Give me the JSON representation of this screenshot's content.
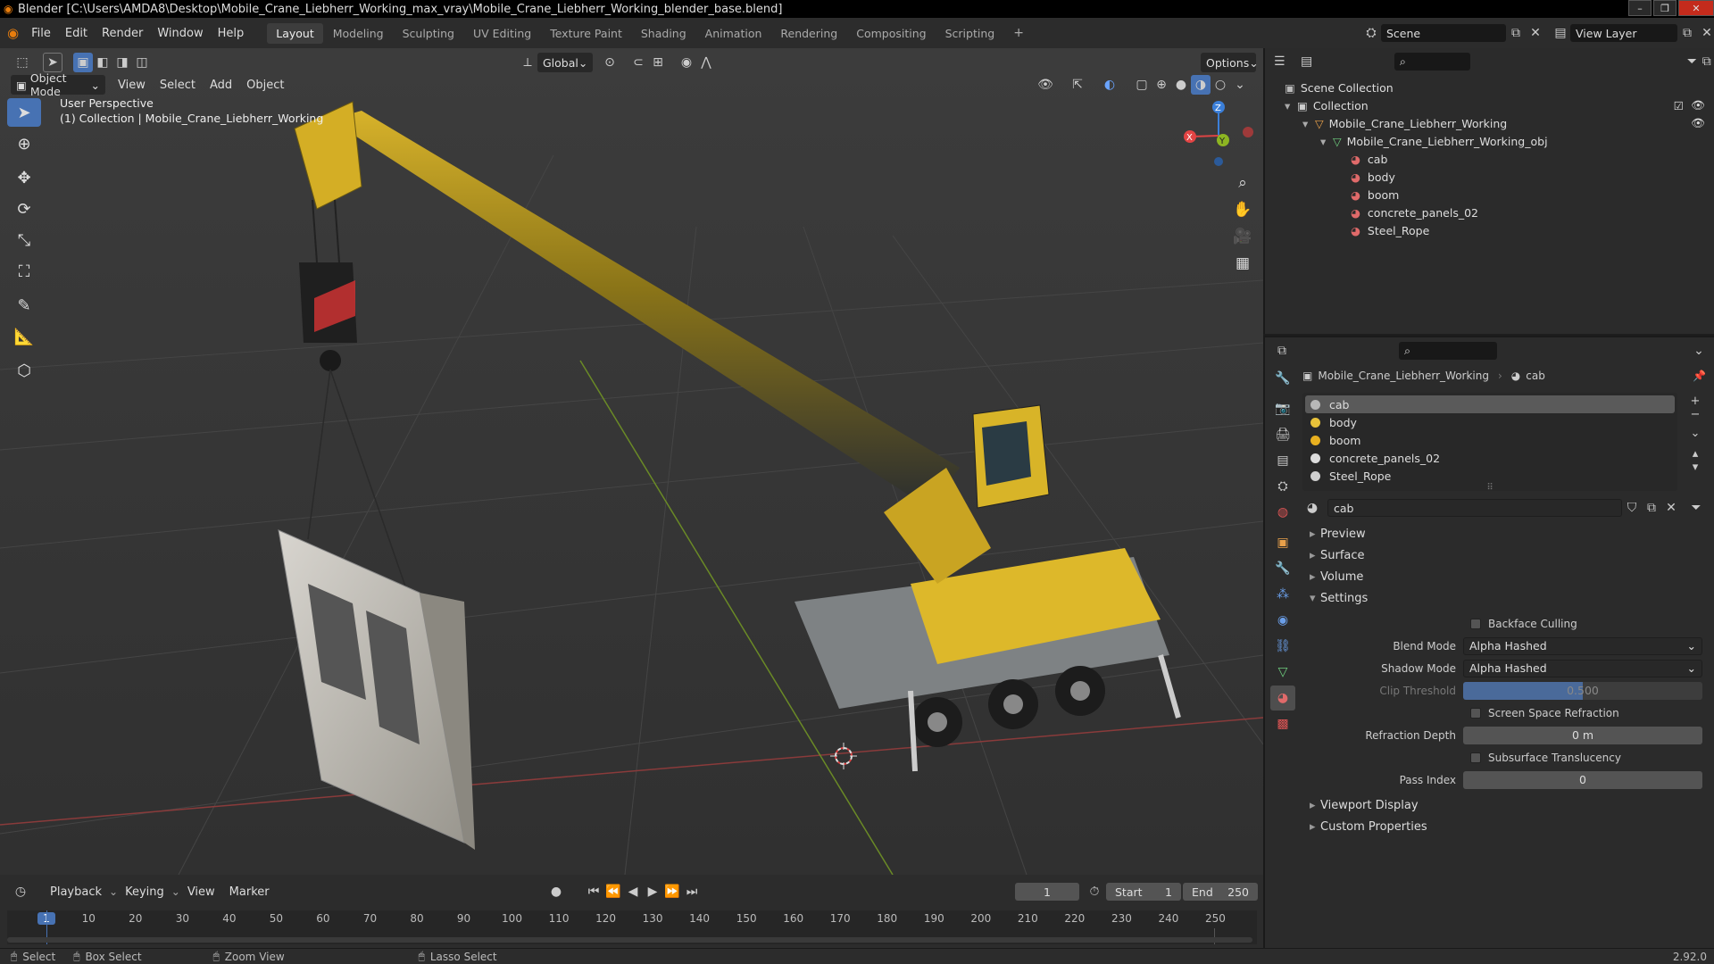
{
  "titlebar": {
    "title": "Blender [C:\\Users\\AMDA8\\Desktop\\Mobile_Crane_Liebherr_Working_max_vray\\Mobile_Crane_Liebherr_Working_blender_base.blend]"
  },
  "menu": [
    "File",
    "Edit",
    "Render",
    "Window",
    "Help"
  ],
  "workspaces": [
    "Layout",
    "Modeling",
    "Sculpting",
    "UV Editing",
    "Texture Paint",
    "Shading",
    "Animation",
    "Rendering",
    "Compositing",
    "Scripting"
  ],
  "scene": {
    "name": "Scene",
    "view_layer": "View Layer"
  },
  "viewport": {
    "mode": "Object Mode",
    "menus": [
      "View",
      "Select",
      "Add",
      "Object"
    ],
    "orientation": "Global",
    "options": "Options",
    "overlay_title": "User Perspective",
    "overlay_subtitle": "(1) Collection | Mobile_Crane_Liebherr_Working",
    "gizmo": {
      "x": "X",
      "y": "Y",
      "z": "Z"
    }
  },
  "outliner": {
    "scene_collection": "Scene Collection",
    "collection": "Collection",
    "object": "Mobile_Crane_Liebherr_Working",
    "mesh": "Mobile_Crane_Liebherr_Working_obj",
    "materials": [
      "cab",
      "body",
      "boom",
      "concrete_panels_02",
      "Steel_Rope"
    ]
  },
  "properties": {
    "breadcrumb_object": "Mobile_Crane_Liebherr_Working",
    "breadcrumb_material": "cab",
    "slots": [
      {
        "name": "cab",
        "color": "#b8b8b8"
      },
      {
        "name": "body",
        "color": "#e8c23a"
      },
      {
        "name": "boom",
        "color": "#e8b020"
      },
      {
        "name": "concrete_panels_02",
        "color": "#dcdcdc"
      },
      {
        "name": "Steel_Rope",
        "color": "#cfcfcf"
      }
    ],
    "material_name": "cab",
    "panels": {
      "preview": "Preview",
      "surface": "Surface",
      "volume": "Volume",
      "settings": "Settings",
      "viewport_display": "Viewport Display",
      "custom_properties": "Custom Properties"
    },
    "settings": {
      "backface_culling": "Backface Culling",
      "blend_mode_label": "Blend Mode",
      "blend_mode": "Alpha Hashed",
      "shadow_mode_label": "Shadow Mode",
      "shadow_mode": "Alpha Hashed",
      "clip_threshold_label": "Clip Threshold",
      "clip_threshold": "0.500",
      "ssr": "Screen Space Refraction",
      "refraction_depth_label": "Refraction Depth",
      "refraction_depth": "0 m",
      "subsurface": "Subsurface Translucency",
      "pass_index_label": "Pass Index",
      "pass_index": "0"
    }
  },
  "timeline": {
    "menus": [
      "Playback",
      "Keying",
      "View",
      "Marker"
    ],
    "current_frame": "1",
    "start_label": "Start",
    "start": "1",
    "end_label": "End",
    "end": "250",
    "ruler": [
      "1",
      "10",
      "20",
      "30",
      "40",
      "50",
      "60",
      "70",
      "80",
      "90",
      "100",
      "110",
      "120",
      "130",
      "140",
      "150",
      "160",
      "170",
      "180",
      "190",
      "200",
      "210",
      "220",
      "230",
      "240",
      "250"
    ]
  },
  "statusbar": {
    "select": "Select",
    "box_select": "Box Select",
    "zoom_view": "Zoom View",
    "lasso_select": "Lasso Select",
    "version": "2.92.0"
  }
}
